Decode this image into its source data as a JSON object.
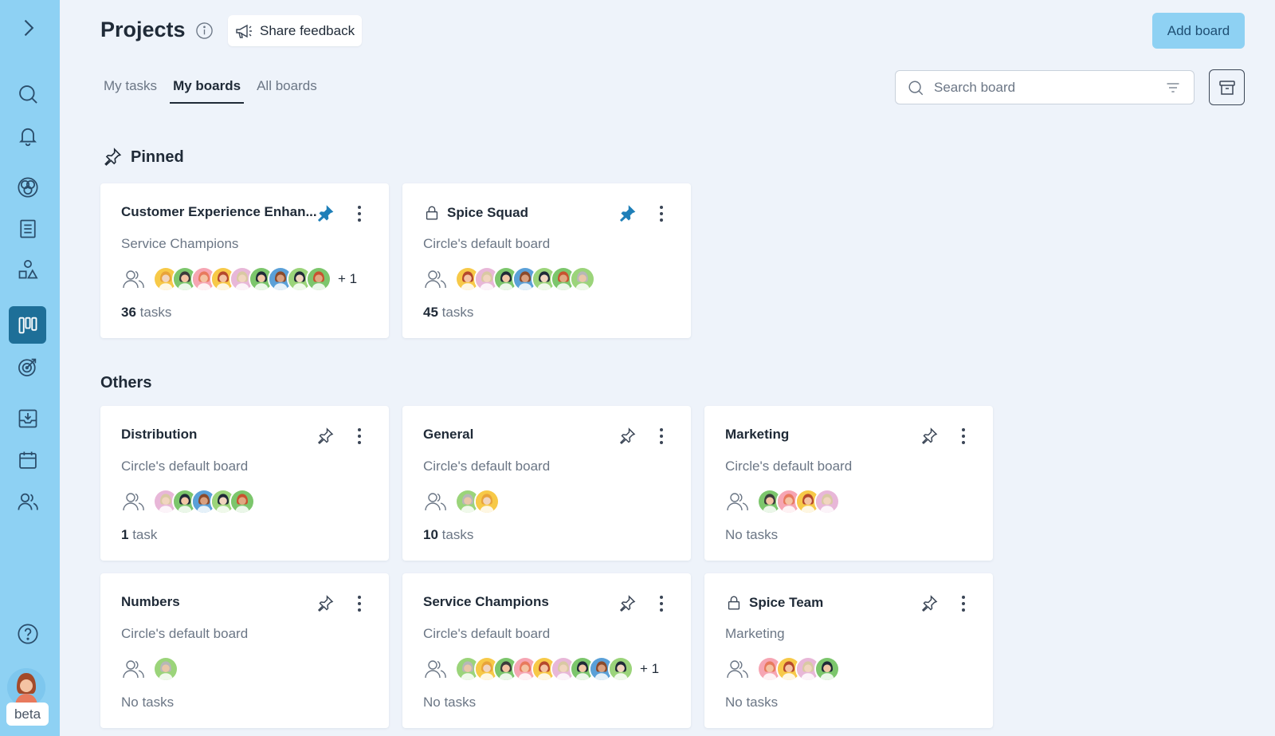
{
  "app": {
    "title": "Projects",
    "feedback_label": "Share feedback",
    "add_board_label": "Add board",
    "beta_label": "beta"
  },
  "sidebar": {
    "items": [
      {
        "icon": "chevron-right-icon"
      },
      {
        "icon": "search-icon"
      },
      {
        "icon": "bell-icon"
      },
      {
        "icon": "circles-icon"
      },
      {
        "icon": "document-icon"
      },
      {
        "icon": "shapes-icon"
      },
      {
        "icon": "boards-icon",
        "active": true
      },
      {
        "icon": "target-icon"
      },
      {
        "icon": "inbox-icon"
      },
      {
        "icon": "calendar-icon"
      },
      {
        "icon": "people-icon"
      },
      {
        "icon": "help-icon"
      }
    ]
  },
  "tabs": [
    {
      "label": "My tasks",
      "active": false
    },
    {
      "label": "My boards",
      "active": true
    },
    {
      "label": "All boards",
      "active": false
    }
  ],
  "search": {
    "placeholder": "Search board"
  },
  "sections": {
    "pinned": "Pinned",
    "others": "Others"
  },
  "pinned_boards": [
    {
      "title": "Customer Experience Enhan...",
      "subtitle": "Service Champions",
      "count": "36",
      "count_label": "tasks",
      "pinned": true,
      "private": false,
      "avatars": 9,
      "extra": "+ 1"
    },
    {
      "title": "Spice Squad",
      "subtitle": "Circle's default board",
      "count": "45",
      "count_label": "tasks",
      "pinned": true,
      "private": true,
      "avatars": 7,
      "extra": ""
    }
  ],
  "other_boards": [
    {
      "title": "Distribution",
      "subtitle": "Circle's default board",
      "count": "1",
      "count_label": "task",
      "pinned": false,
      "private": false,
      "avatars": 5,
      "extra": ""
    },
    {
      "title": "General",
      "subtitle": "Circle's default board",
      "count": "10",
      "count_label": "tasks",
      "pinned": false,
      "private": false,
      "avatars": 2,
      "extra": ""
    },
    {
      "title": "Marketing",
      "subtitle": "Circle's default board",
      "count": "",
      "count_label": "No tasks",
      "pinned": false,
      "private": false,
      "avatars": 4,
      "extra": ""
    },
    {
      "title": "Numbers",
      "subtitle": "Circle's default board",
      "count": "",
      "count_label": "No tasks",
      "pinned": false,
      "private": false,
      "avatars": 1,
      "extra": ""
    },
    {
      "title": "Service Champions",
      "subtitle": "Circle's default board",
      "count": "",
      "count_label": "No tasks",
      "pinned": false,
      "private": false,
      "avatars": 9,
      "extra": "+ 1"
    },
    {
      "title": "Spice Team",
      "subtitle": "Marketing",
      "count": "",
      "count_label": "No tasks",
      "pinned": false,
      "private": true,
      "avatars": 4,
      "extra": ""
    }
  ],
  "colors": {
    "sidebar": "#8ed1f3",
    "active_nav": "#1e6f98",
    "pin_active": "#1e7fb8",
    "background": "#eef3fa"
  }
}
